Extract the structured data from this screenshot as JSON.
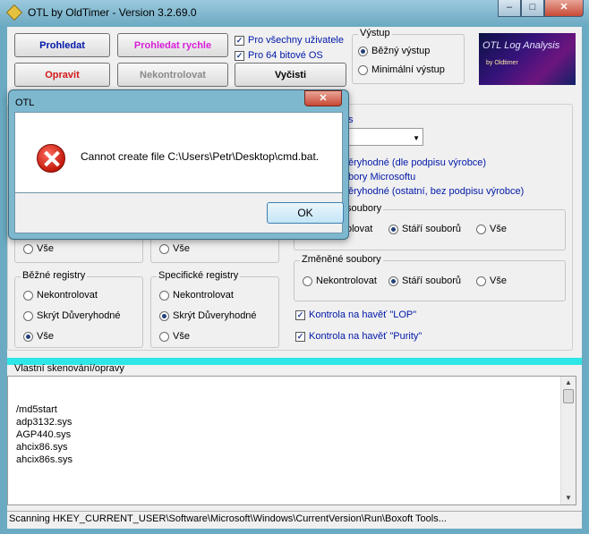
{
  "window": {
    "title": "OTL by OldTimer - Version 3.2.69.0",
    "caption": {
      "minimize": "–",
      "maximize": "□",
      "close": "✕"
    }
  },
  "toolbar": {
    "scan": "Prohledat",
    "scan_fast": "Prohledat rychle",
    "fix": "Opravit",
    "no_check": "Nekontrolovat",
    "clean": "Vyčisti"
  },
  "options": {
    "all_users": "Pro všechny uživatele",
    "os64": "Pro 64 bitové OS"
  },
  "output_group": {
    "title": "Výstup",
    "normal": "Běžný výstup",
    "minimal": "Minimální výstup"
  },
  "logo": {
    "title": "OTL Log Analysis",
    "subtitle": "by Oldtimer"
  },
  "right_panel": {
    "combo_caption": "s",
    "trusted_sig": "ěryhodné (dle podpisu výrobce)",
    "ms_files": "bory Microsoftu",
    "trusted_other": "ěryhodné (ostatní, bez podpisu výrobce)",
    "files_group": "soubory",
    "files_opt1": "olovat",
    "files_opt2": "Stáří souborů",
    "files_opt3": "Vše",
    "changed_group": "Změněné soubory",
    "changed_opt1": "Nekontrolovat",
    "changed_opt2": "Stáří souborů",
    "changed_opt3": "Vše",
    "lop": "Kontrola na havěť \"LOP\"",
    "purity": "Kontrola na havěť \"Purity\""
  },
  "left_groups": {
    "row1_all_a": "Vše",
    "row1_all_b": "Vše",
    "common": {
      "title": "Běžné registry",
      "opt1": "Nekontrolovat",
      "opt2": "Skrýt Důveryhodné",
      "opt3": "Vše"
    },
    "specific": {
      "title": "Specifické registry",
      "opt1": "Nekontrolovat",
      "opt2": "Skrýt Důveryhodné",
      "opt3": "Vše"
    }
  },
  "custom": {
    "title": "Vlastní skenování/opravy",
    "lines": [
      "/md5start",
      "adp3132.sys",
      "AGP440.sys",
      "ahcix86.sys",
      "ahcix86s.sys"
    ]
  },
  "status": "Scanning HKEY_CURRENT_USER\\Software\\Microsoft\\Windows\\CurrentVersion\\Run\\Boxoft Tools...",
  "dialog": {
    "title": "OTL",
    "message": "Cannot create file C:\\Users\\Petr\\Desktop\\cmd.bat.",
    "ok": "OK",
    "close": "✕"
  }
}
